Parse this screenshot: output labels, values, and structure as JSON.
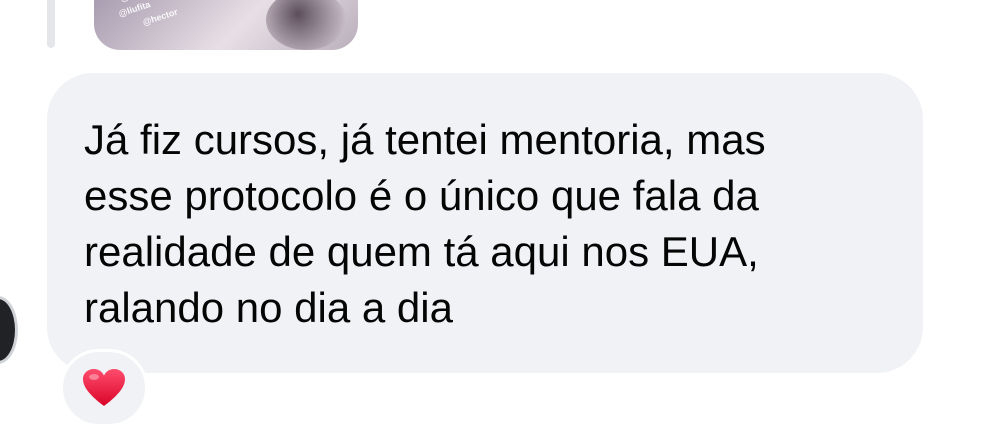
{
  "story_reply": {
    "thumbnail_handles": [
      "@t",
      "@liufita",
      "@hector"
    ]
  },
  "message": {
    "lines": [
      "Já fiz cursos, já tentei mentoria, mas",
      "esse protocolo é o único que fala da",
      "realidade de quem tá aqui nos EUA,",
      "ralando no dia a dia"
    ]
  },
  "reaction": {
    "icon": "red-heart-icon",
    "color": "#e0245e"
  },
  "colors": {
    "bubble_background": "#f0f2f5",
    "text": "#050505",
    "page_background": "#ffffff"
  }
}
